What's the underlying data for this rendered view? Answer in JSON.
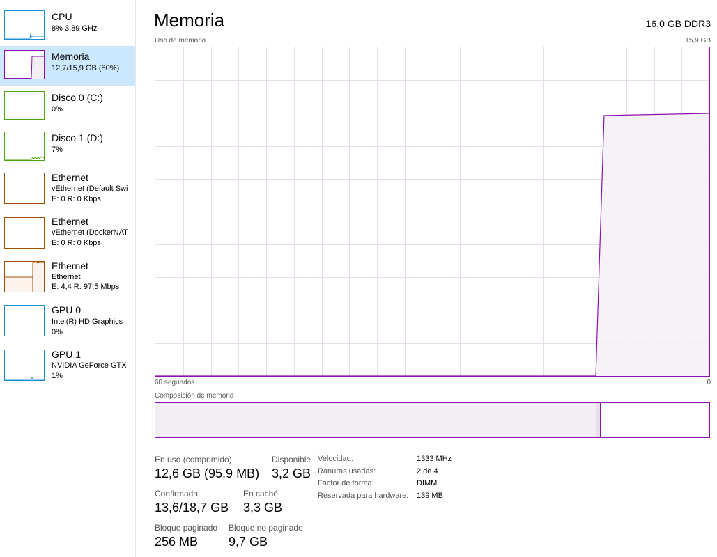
{
  "sidebar": {
    "items": [
      {
        "title": "CPU",
        "line1": "8%  3,89 GHz",
        "line2": "",
        "color": "#1a8fd4"
      },
      {
        "title": "Memoria",
        "line1": "12,7/15,9 GB (80%)",
        "line2": "",
        "color": "#8b12ae"
      },
      {
        "title": "Disco 0 (C:)",
        "line1": "0%",
        "line2": "",
        "color": "#4da60c"
      },
      {
        "title": "Disco 1 (D:)",
        "line1": "7%",
        "line2": "",
        "color": "#4da60c"
      },
      {
        "title": "Ethernet",
        "line1": "vEthernet (Default Switch)",
        "line2": "E: 0  R: 0 Kbps",
        "color": "#a74f01"
      },
      {
        "title": "Ethernet",
        "line1": "vEthernet (DockerNAT)",
        "line2": "E: 0  R: 0 Kbps",
        "color": "#a74f01"
      },
      {
        "title": "Ethernet",
        "line1": "Ethernet",
        "line2": "E: 4,4  R: 97,5 Mbps",
        "color": "#a74f01"
      },
      {
        "title": "GPU 0",
        "line1": "Intel(R) HD Graphics",
        "line2": "0%",
        "color": "#1a8fd4"
      },
      {
        "title": "GPU 1",
        "line1": "NVIDIA GeForce GTX",
        "line2": "1%",
        "color": "#1a8fd4"
      }
    ],
    "selected_index": 1
  },
  "main": {
    "title": "Memoria",
    "hardware": "16,0 GB DDR3",
    "graph_label": "Uso de memoria",
    "graph_max": "15,9 GB",
    "time_left": "60 segundos",
    "time_right": "0",
    "composition_label": "Composición de memoria",
    "accent_color": "#8b12ae"
  },
  "memory_usage": {
    "max_gb": 15.9,
    "points_seconds_ago": [
      60,
      12.3,
      11.4,
      0
    ],
    "points_gb": [
      0,
      0,
      12.6,
      12.7
    ]
  },
  "composition": {
    "in_use_fraction": 0.795,
    "modified_fraction": 0.009
  },
  "stats": {
    "in_use_label": "En uso (comprimido)",
    "in_use_value": "12,6 GB (95,9 MB)",
    "available_label": "Disponible",
    "available_value": "3,2 GB",
    "committed_label": "Confirmada",
    "committed_value": "13,6/18,7 GB",
    "cached_label": "En caché",
    "cached_value": "3,3 GB",
    "paged_label": "Bloque paginado",
    "paged_value": "256 MB",
    "nonpaged_label": "Bloque no paginado",
    "nonpaged_value": "9,7 GB"
  },
  "details": [
    {
      "key": "Velocidad:",
      "value": "1333 MHz"
    },
    {
      "key": "Ranuras usadas:",
      "value": "2 de 4"
    },
    {
      "key": "Factor de forma:",
      "value": "DIMM"
    },
    {
      "key": "Reservada para hardware:",
      "value": "139 MB"
    }
  ]
}
